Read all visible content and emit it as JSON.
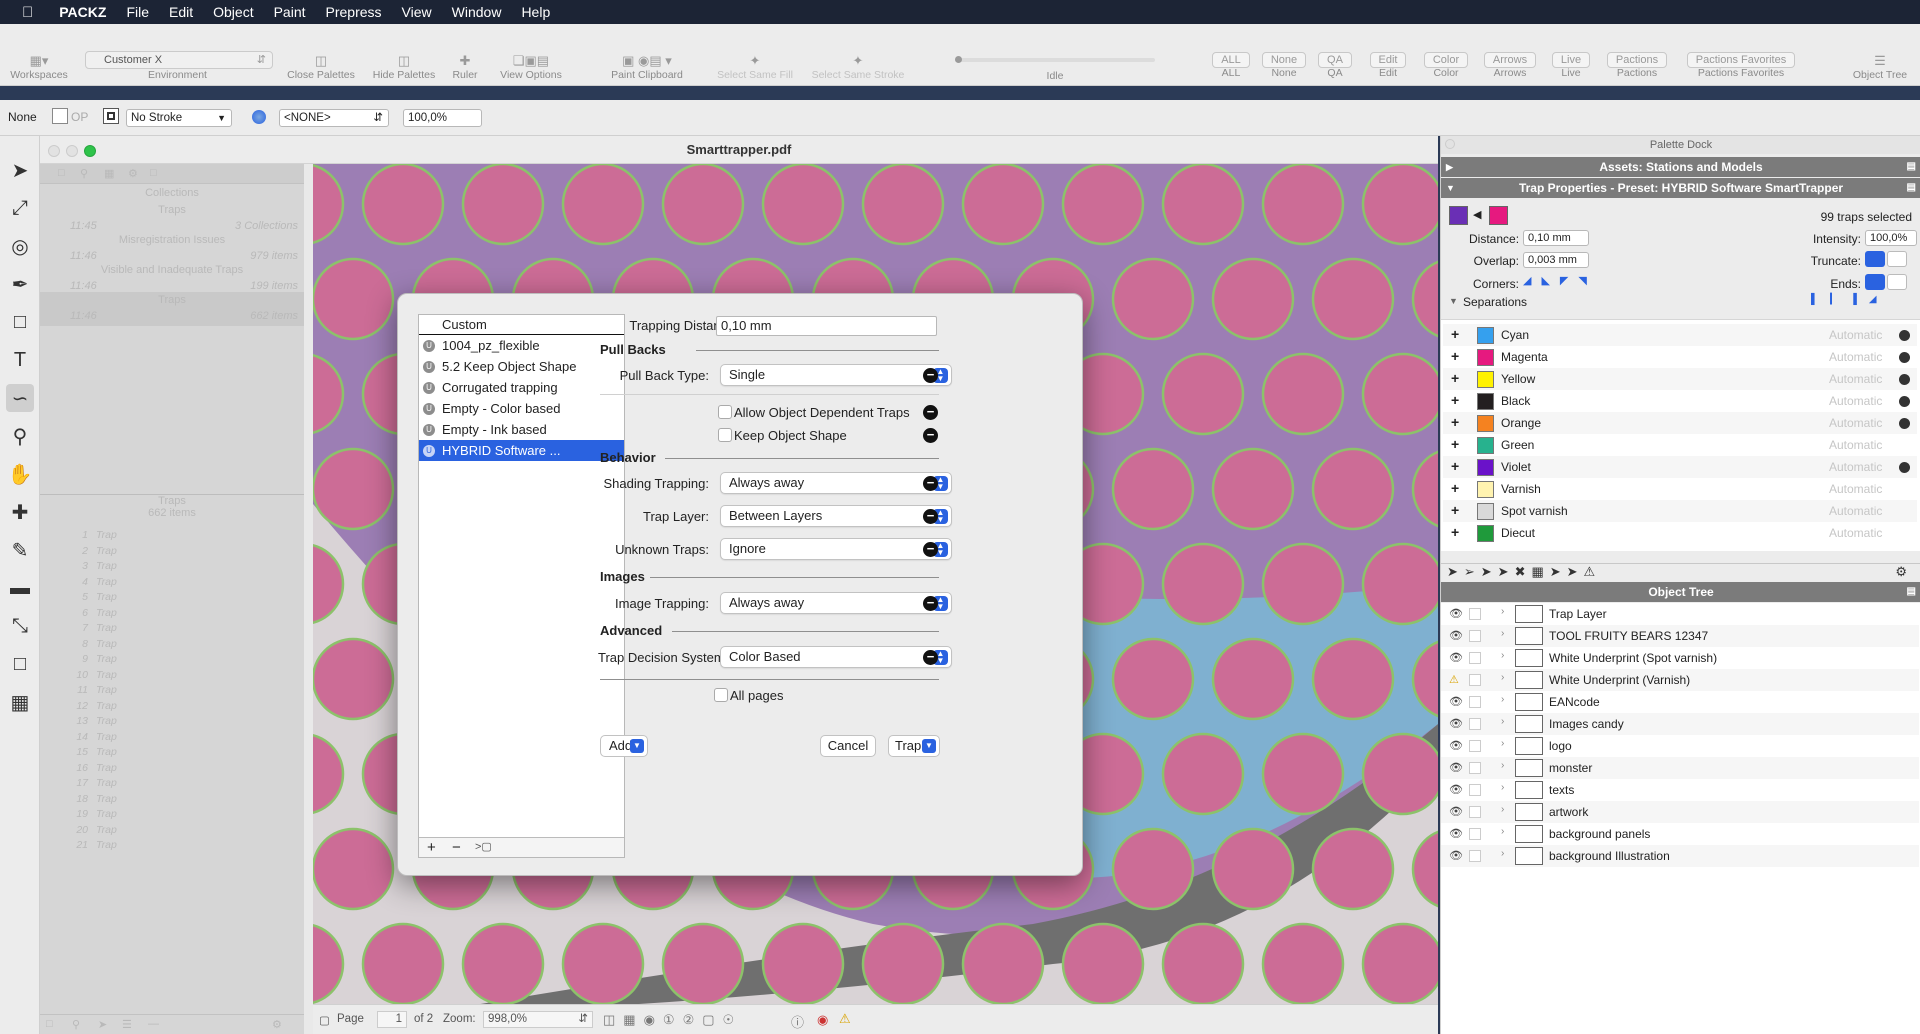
{
  "menubar": {
    "app": "PACKZ",
    "items": [
      "File",
      "Edit",
      "Object",
      "Paint",
      "Prepress",
      "View",
      "Window",
      "Help"
    ]
  },
  "toolbar": {
    "workspaces": "Workspaces",
    "environment_value": "Customer X",
    "environment": "Environment",
    "close_palettes": "Close Palettes",
    "hide_palettes": "Hide Palettes",
    "ruler": "Ruler",
    "view_options": "View Options",
    "paint_clipboard": "Paint Clipboard",
    "select_same_fill": "Select Same Fill",
    "select_same_stroke": "Select Same Stroke",
    "idle": "Idle",
    "pills": [
      {
        "top": "ALL",
        "bottom": "ALL"
      },
      {
        "top": "None",
        "bottom": "None"
      },
      {
        "top": "QA",
        "bottom": "QA"
      },
      {
        "top": "Edit",
        "bottom": "Edit"
      },
      {
        "top": "Color",
        "bottom": "Color"
      },
      {
        "top": "Arrows",
        "bottom": "Arrows"
      },
      {
        "top": "Live",
        "bottom": "Live"
      },
      {
        "top": "Pactions",
        "bottom": "Pactions"
      },
      {
        "top": "Pactions Favorites",
        "bottom": "Pactions Favorites"
      }
    ],
    "object_tree": "Object Tree"
  },
  "propbar": {
    "fill": "None",
    "op": "OP",
    "stroke": "No Stroke",
    "separation": "<NONE>",
    "opacity": "100,0%"
  },
  "document": {
    "title": "Smarttrapper.pdf",
    "left": {
      "collections": "Collections",
      "traps": "Traps",
      "time1": "11:45",
      "collections_count": "3 Collections",
      "misreg": "Misregistration Issues",
      "time2": "11:46",
      "items1": "979 items",
      "visible": "Visible and Inadequate Traps",
      "time3": "11:46",
      "items2": "199 items",
      "traps2": "Traps",
      "time4": "11:46",
      "items3": "662 items",
      "traps_header": "Traps",
      "traps_count": "662 items",
      "rows": [
        "1",
        "2",
        "3",
        "4",
        "5",
        "6",
        "7",
        "8",
        "9",
        "10",
        "11",
        "12",
        "13",
        "14",
        "15",
        "16",
        "17",
        "18",
        "19",
        "20",
        "21"
      ],
      "row_label": "Trap"
    },
    "status": {
      "page_label": "Page",
      "page": "1",
      "of": "of 2",
      "zoom_label": "Zoom:",
      "zoom": "998,0%"
    }
  },
  "dialog": {
    "list_header": "Custom",
    "presets": [
      "1004_pz_flexible",
      "5.2 Keep Object Shape",
      "Corrugated trapping",
      "Empty - Color based",
      "Empty - Ink based",
      "HYBRID Software ..."
    ],
    "trapping_distance_label": "Trapping Distance:",
    "trapping_distance": "0,10 mm",
    "pullbacks": "Pull Backs",
    "pullback_type_label": "Pull Back Type:",
    "pullback_type": "Single",
    "allow_object": "Allow Object Dependent Traps",
    "keep_shape": "Keep Object Shape",
    "behavior": "Behavior",
    "shading_label": "Shading Trapping:",
    "shading": "Always away",
    "trap_layer_label": "Trap Layer:",
    "trap_layer": "Between Layers",
    "unknown_label": "Unknown Traps:",
    "unknown": "Ignore",
    "images": "Images",
    "image_label": "Image Trapping:",
    "image": "Always away",
    "advanced": "Advanced",
    "decision_label": "Trap Decision System:",
    "decision": "Color Based",
    "all_pages": "All pages",
    "add": "Add",
    "cancel": "Cancel",
    "trap": "Trap"
  },
  "palette": {
    "dock": "Palette Dock",
    "assets": "Assets: Stations and Models",
    "trap_props": "Trap Properties - Preset: HYBRID Software SmartTrapper",
    "selected": "99 traps selected",
    "distance_label": "Distance:",
    "distance": "0,10 mm",
    "intensity_label": "Intensity:",
    "intensity": "100,0%",
    "overlap_label": "Overlap:",
    "overlap": "0,003 mm",
    "truncate_label": "Truncate:",
    "corners_label": "Corners:",
    "ends_label": "Ends:",
    "separations_label": "Separations",
    "separations": [
      {
        "name": "Cyan",
        "mode": "Automatic",
        "color": "#35a0ee"
      },
      {
        "name": "Magenta",
        "mode": "Automatic",
        "color": "#e6197f"
      },
      {
        "name": "Yellow",
        "mode": "Automatic",
        "color": "#fff200"
      },
      {
        "name": "Black",
        "mode": "Automatic",
        "color": "#231f20"
      },
      {
        "name": "Orange",
        "mode": "Automatic",
        "color": "#f58220"
      },
      {
        "name": "Green",
        "mode": "Automatic",
        "color": "#27b28e"
      },
      {
        "name": "Violet",
        "mode": "Automatic",
        "color": "#6a12c9"
      },
      {
        "name": "Varnish",
        "mode": "Automatic",
        "color": "#fff3b0"
      },
      {
        "name": "Spot varnish",
        "mode": "Automatic",
        "color": "#d9d9d9"
      },
      {
        "name": "Diecut",
        "mode": "Automatic",
        "color": "#1f9a3b"
      }
    ],
    "object_tree": "Object Tree",
    "objects": [
      "Trap Layer",
      "TOOL FRUITY BEARS 12347",
      "White Underprint (Spot varnish)",
      "White Underprint (Varnish)",
      "EANcode",
      "Images candy",
      "logo",
      "monster",
      "texts",
      "artwork",
      "background panels",
      "background Illustration"
    ]
  },
  "colors": {
    "accent": "#2a62e0",
    "fill_swatch": "#6a2fb5",
    "stroke_swatch": "#e6197f"
  }
}
